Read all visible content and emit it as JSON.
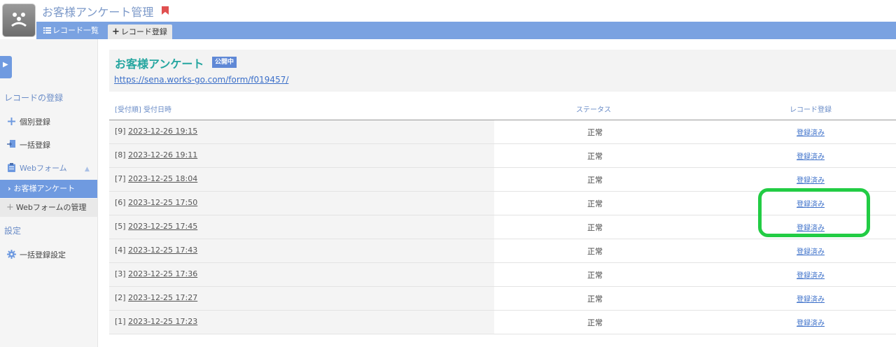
{
  "header": {
    "app_title": "お客様アンケート管理",
    "tabs": [
      {
        "label": "レコード一覧"
      },
      {
        "label": "レコード登録"
      }
    ]
  },
  "sidebar": {
    "section_register": "レコードの登録",
    "items": [
      {
        "label": "個別登録",
        "icon": "plus-icon"
      },
      {
        "label": "一括登録",
        "icon": "import-icon"
      },
      {
        "label": "Webフォーム",
        "icon": "clipboard-icon"
      }
    ],
    "active_item": "お客様アンケート",
    "manage_item": "Webフォームの管理",
    "section_settings": "設定",
    "settings_items": [
      {
        "label": "一括登録設定",
        "icon": "gear-icon"
      }
    ]
  },
  "form": {
    "title": "お客様アンケート",
    "status_badge": "公開中",
    "url": "https://sena.works-go.com/form/f019457/"
  },
  "table": {
    "columns": [
      "[受付順] 受付日時",
      "ステータス",
      "レコード登録"
    ],
    "rows": [
      {
        "order": "[9]",
        "datetime": "2023-12-26 19:15",
        "status": "正常",
        "registration": "登録済み"
      },
      {
        "order": "[8]",
        "datetime": "2023-12-26 19:11",
        "status": "正常",
        "registration": "登録済み"
      },
      {
        "order": "[7]",
        "datetime": "2023-12-25 18:04",
        "status": "正常",
        "registration": "登録済み"
      },
      {
        "order": "[6]",
        "datetime": "2023-12-25 17:50",
        "status": "正常",
        "registration": "登録済み"
      },
      {
        "order": "[5]",
        "datetime": "2023-12-25 17:45",
        "status": "正常",
        "registration": "登録済み"
      },
      {
        "order": "[4]",
        "datetime": "2023-12-25 17:43",
        "status": "正常",
        "registration": "登録済み"
      },
      {
        "order": "[3]",
        "datetime": "2023-12-25 17:36",
        "status": "正常",
        "registration": "登録済み"
      },
      {
        "order": "[2]",
        "datetime": "2023-12-25 17:27",
        "status": "正常",
        "registration": "登録済み"
      },
      {
        "order": "[1]",
        "datetime": "2023-12-25 17:23",
        "status": "正常",
        "registration": "登録済み"
      }
    ]
  },
  "colors": {
    "accent": "#7aa2e1",
    "title_teal": "#26a6a0",
    "highlight_green": "#22cc44"
  }
}
